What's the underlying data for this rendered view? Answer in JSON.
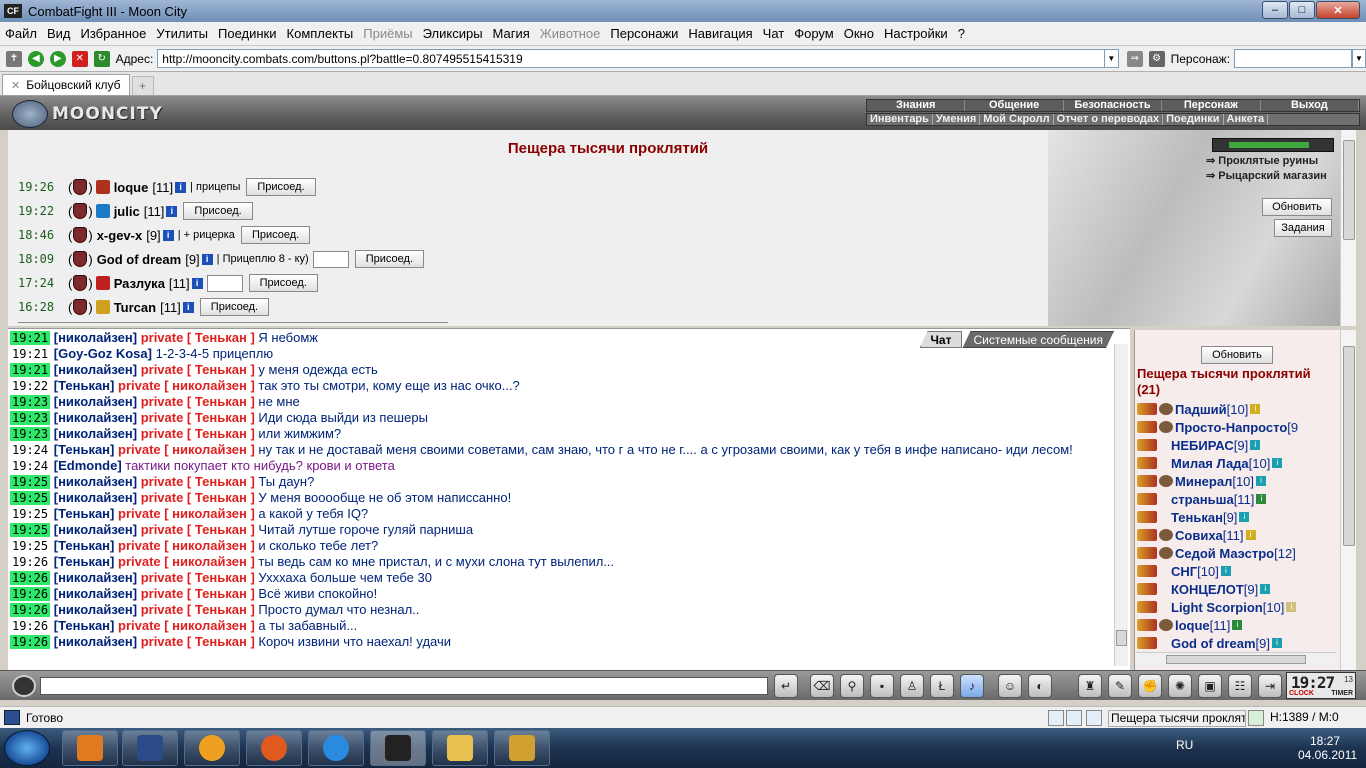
{
  "window": {
    "icon_text": "CF",
    "title": "CombatFight III - Moon City",
    "min": "–",
    "max": "□",
    "close": "✕"
  },
  "menu": [
    "Файл",
    "Вид",
    "Избранное",
    "Утилиты",
    "Поединки",
    "Комплекты",
    "Приёмы",
    "Эликсиры",
    "Магия",
    "Животное",
    "Персонажи",
    "Навигация",
    "Чат",
    "Форум",
    "Окно",
    "Настройки",
    "?"
  ],
  "menu_dim": [
    "Приёмы",
    "Животное"
  ],
  "address": {
    "label": "Адрес:",
    "url": "http://mooncity.combats.com/buttons.pl?battle=0.807495515415319",
    "person_label": "Персонаж:"
  },
  "tab": {
    "label": "Бойцовский клуб",
    "close": "✕",
    "new": "+"
  },
  "game_header": {
    "brand": "MOONCITY",
    "nav1": [
      "Знания",
      "Общение",
      "Безопасность",
      "Персонаж",
      "Выход"
    ],
    "nav2": [
      "Инвентарь",
      "Умения",
      "Мой Скролл",
      "Отчет о переводах",
      "Поединки",
      "Анкета"
    ]
  },
  "location": {
    "title": "Пещера тысячи проклятий",
    "links": [
      "Проклятые руины",
      "Рыцарский магазин"
    ],
    "refresh_button": "Обновить",
    "tasks_button": "Задания",
    "join_label": "Присоед.",
    "battles": [
      {
        "time": "19:26",
        "name": "loque",
        "level": "[11]",
        "note": "| прицепы",
        "icon_color": "#b03020",
        "has_input": false
      },
      {
        "time": "19:22",
        "name": "julic",
        "level": "[11]",
        "note": "",
        "icon_color": "#1a7ac8",
        "has_input": false
      },
      {
        "time": "18:46",
        "name": "x-gev-x",
        "level": "[9]",
        "note": "| + рицерка",
        "icon_color": "",
        "has_input": false
      },
      {
        "time": "18:09",
        "name": "God of dream",
        "level": "[9]",
        "note": "| Прицеплю 8 - ку)",
        "icon_color": "",
        "has_input": true
      },
      {
        "time": "17:24",
        "name": "Разлука",
        "level": "[11]",
        "note": "",
        "icon_color": "#c02020",
        "has_input": true
      },
      {
        "time": "16:28",
        "name": "Turcan",
        "level": "[11]",
        "note": "",
        "icon_color": "#d0a020",
        "has_input": false
      }
    ]
  },
  "chat": {
    "tabs": [
      "Чат",
      "Системные сообщения"
    ],
    "messages": [
      {
        "time": "19:21",
        "hi": true,
        "from": "николайзен",
        "private": "private [ Тенькан ]",
        "text": "Я небомж"
      },
      {
        "time": "19:21",
        "hi": false,
        "from": "Goy-Goz Kosa",
        "private": "",
        "text": "1-2-3-4-5 прицеплю"
      },
      {
        "time": "19:21",
        "hi": true,
        "from": "николайзен",
        "private": "private [ Тенькан ]",
        "text": "у меня одежда есть"
      },
      {
        "time": "19:22",
        "hi": false,
        "from": "Тенькан",
        "private": "private [ николайзен ]",
        "text": "так это ты смотри, кому еще из нас очко...?"
      },
      {
        "time": "19:23",
        "hi": true,
        "from": "николайзен",
        "private": "private [ Тенькан ]",
        "text": "не мне"
      },
      {
        "time": "19:23",
        "hi": true,
        "from": "николайзен",
        "private": "private [ Тенькан ]",
        "text": "Иди сюда выйди из пешеры"
      },
      {
        "time": "19:23",
        "hi": true,
        "from": "николайзен",
        "private": "private [ Тенькан ]",
        "text": "или жимжим?"
      },
      {
        "time": "19:24",
        "hi": false,
        "from": "Тенькан",
        "private": "private [ николайзен ]",
        "text": "ну так и не доставай меня своими советами, сам знаю, что г а что не г.... а с угрозами своими, как у тебя в инфе написано- иди лесом!",
        "wrap": true
      },
      {
        "time": "19:24",
        "hi": false,
        "from": "Edmonde",
        "private": "",
        "text": "тактики покупает кто нибудь? крови и ответа",
        "purple": true
      },
      {
        "time": "19:25",
        "hi": true,
        "from": "николайзен",
        "private": "private [ Тенькан ]",
        "text": "Ты даун?"
      },
      {
        "time": "19:25",
        "hi": true,
        "from": "николайзен",
        "private": "private [ Тенькан ]",
        "text": "У меня вооообще не об этом написсанно!"
      },
      {
        "time": "19:25",
        "hi": false,
        "from": "Тенькан",
        "private": "private [ николайзен ]",
        "text": "а какой у тебя IQ?"
      },
      {
        "time": "19:25",
        "hi": true,
        "from": "николайзен",
        "private": "private [ Тенькан ]",
        "text": "Читай лутше гороче гуляй парниша"
      },
      {
        "time": "19:25",
        "hi": false,
        "from": "Тенькан",
        "private": "private [ николайзен ]",
        "text": "и сколько тебе лет?"
      },
      {
        "time": "19:26",
        "hi": false,
        "from": "Тенькан",
        "private": "private [ николайзен ]",
        "text": "ты ведь сам ко мне пристал, и с мухи слона тут вылепил..."
      },
      {
        "time": "19:26",
        "hi": true,
        "from": "николайзен",
        "private": "private [ Тенькан ]",
        "text": "Ухххаха больше чем тебе 30"
      },
      {
        "time": "19:26",
        "hi": true,
        "from": "николайзен",
        "private": "private [ Тенькан ]",
        "text": "Всё живи спокойно!"
      },
      {
        "time": "19:26",
        "hi": true,
        "from": "николайзен",
        "private": "private [ Тенькан ]",
        "text": "Просто думал что незнал.."
      },
      {
        "time": "19:26",
        "hi": false,
        "from": "Тенькан",
        "private": "private [ николайзен ]",
        "text": "а ты забавный..."
      },
      {
        "time": "19:26",
        "hi": true,
        "from": "николайзен",
        "private": "private [ Тенькан ]",
        "text": "Короч извини что наехал! удачи"
      }
    ]
  },
  "room": {
    "refresh_button": "Обновить",
    "title": "Пещера тысячи проклятий (21)",
    "users": [
      {
        "name": "Падший",
        "level": "[10]",
        "badge": "#d0b020",
        "icons": true
      },
      {
        "name": "Просто-Напросто",
        "level": "[9",
        "badge": "",
        "icons": true
      },
      {
        "name": "НЕБИРАС",
        "level": "[9]",
        "badge": "#1aa0b0",
        "icons": false
      },
      {
        "name": "Милая Лада",
        "level": "[10]",
        "badge": "#1aa0b0",
        "icons": false
      },
      {
        "name": "Минерал",
        "level": "[10]",
        "badge": "#1aa0b0",
        "icons": true
      },
      {
        "name": "страньша",
        "level": "[11]",
        "badge": "#2a8a3a",
        "icons": false
      },
      {
        "name": "Тенькан",
        "level": "[9]",
        "badge": "#1aa0b0",
        "icons": false
      },
      {
        "name": "Совиха",
        "level": "[11]",
        "badge": "#d0b020",
        "icons": true
      },
      {
        "name": "Седой Маэстро",
        "level": "[12]",
        "badge": "",
        "icons": true
      },
      {
        "name": "СНГ",
        "level": "[10]",
        "badge": "#1aa0b0",
        "icons": false
      },
      {
        "name": "КОНЦЕЛОТ",
        "level": "[9]",
        "badge": "#1aa0b0",
        "icons": false
      },
      {
        "name": "Light Scorpion",
        "level": "[10]",
        "badge": "#d0c080",
        "icons": false
      },
      {
        "name": "loque",
        "level": "[11]",
        "badge": "#2a8a3a",
        "icons": true
      },
      {
        "name": "God of dream",
        "level": "[9]",
        "badge": "#1aa0b0",
        "icons": false
      }
    ]
  },
  "bottombar": {
    "input_value": "",
    "clock_time": "19:27",
    "clock_sec": "13",
    "clock_label": "CLOCK",
    "timer_label": "TIMER"
  },
  "status": {
    "text": "Готово",
    "location": "Пещера тысячи проклят",
    "hp": "H:1389 / M:0"
  },
  "taskbar": {
    "lang": "RU",
    "time": "18:27",
    "date": "04.06.2011"
  }
}
